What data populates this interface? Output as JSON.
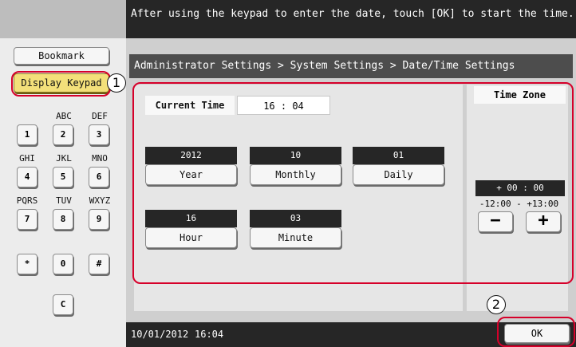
{
  "header": {
    "message": "After using the keypad to enter the date, touch [OK] to start the time."
  },
  "left_panel": {
    "bookmark_label": "Bookmark",
    "display_keypad_label": "Display Keypad",
    "keypad": {
      "keys": [
        "1",
        "2",
        "3",
        "4",
        "5",
        "6",
        "7",
        "8",
        "9",
        "*",
        "0",
        "#",
        "C"
      ],
      "sublabels": {
        "2": "ABC",
        "3": "DEF",
        "4": "GHI",
        "5": "JKL",
        "6": "MNO",
        "7": "PQRS",
        "8": "TUV",
        "9": "WXYZ"
      }
    }
  },
  "main": {
    "breadcrumb": "Administrator Settings > System Settings > Date/Time Settings",
    "current_time_label": "Current Time",
    "current_time_value": "16 : 04",
    "fields": [
      {
        "value": "2012",
        "label": "Year"
      },
      {
        "value": "10",
        "label": "Monthly"
      },
      {
        "value": "01",
        "label": "Daily"
      },
      {
        "value": "16",
        "label": "Hour"
      },
      {
        "value": "03",
        "label": "Minute"
      }
    ],
    "time_zone": {
      "label": "Time Zone",
      "value": "+ 00 : 00",
      "range": "-12:00 - +13:00",
      "minus": "−",
      "plus": "+"
    }
  },
  "status_bar": {
    "date": "10/01/2012",
    "time": "16:04",
    "ok_label": "OK"
  },
  "annotations": {
    "callout_1": "1",
    "callout_2": "2",
    "color": "#d6002a"
  }
}
